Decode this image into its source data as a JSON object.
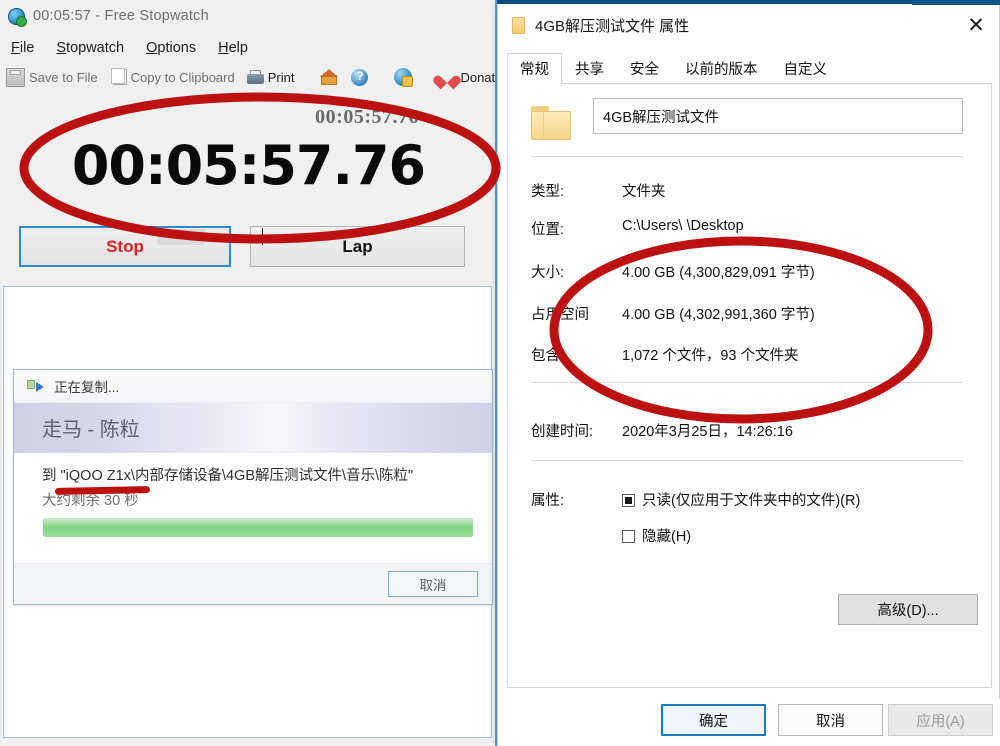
{
  "stopwatch": {
    "titlebar": {
      "icon": "stopwatch-app-icon",
      "title": "00:05:57 - Free Stopwatch"
    },
    "menu": [
      {
        "label": "File"
      },
      {
        "label": "Stopwatch"
      },
      {
        "label": "Options"
      },
      {
        "label": "Help"
      }
    ],
    "toolbar": [
      {
        "icon": "save-icon",
        "label": "Save to File"
      },
      {
        "icon": "copy-icon",
        "label": "Copy to Clipboard"
      },
      {
        "icon": "print-icon",
        "label": "Print"
      },
      {
        "icon": "home-icon",
        "label": ""
      },
      {
        "icon": "help-icon",
        "label": ""
      },
      {
        "icon": "update-icon",
        "label": ""
      },
      {
        "icon": "heart-icon",
        "label": "Donat"
      }
    ],
    "display": {
      "small_time": "00:05:57.76",
      "big_time": "00:05:57.76"
    },
    "buttons": {
      "stop": "Stop",
      "lap": "Lap"
    }
  },
  "copy_dialog": {
    "title": "正在复制...",
    "song": "走马 - 陈粒",
    "destination": "到 \"iQOO Z1x\\内部存储设备\\4GB解压测试文件\\音乐\\陈粒\"",
    "remaining": "大约剩余 30 秒",
    "cancel": "取消",
    "progress_color": "#7fd183"
  },
  "properties": {
    "title": "4GB解压测试文件 属性",
    "close_glyph": "✕",
    "tabs": [
      {
        "label": "常规",
        "active": true
      },
      {
        "label": "共享",
        "active": false
      },
      {
        "label": "安全",
        "active": false
      },
      {
        "label": "以前的版本",
        "active": false
      },
      {
        "label": "自定义",
        "active": false
      }
    ],
    "name_value": "4GB解压测试文件",
    "rows": [
      {
        "label": "类型:",
        "value": "文件夹"
      },
      {
        "label": "位置:",
        "value": "C:\\Users\\        \\Desktop"
      },
      {
        "label": "大小:",
        "value": "4.00 GB (4,300,829,091 字节)"
      },
      {
        "label": "占用空间",
        "value": "4.00 GB (4,302,991,360 字节)"
      },
      {
        "label": "包含:",
        "value": "1,072 个文件，93 个文件夹"
      },
      {
        "label": "创建时间:",
        "value": "2020年3月25日，14:26:16"
      }
    ],
    "attributes_label": "属性:",
    "readonly_label": "只读(仅应用于文件夹中的文件)(R)",
    "hidden_label": "隐藏(H)",
    "advanced_label": "高级(D)...",
    "footer": {
      "ok": "确定",
      "cancel": "取消",
      "apply": "应用(A)"
    }
  },
  "annotations": {
    "color": "#bb1111",
    "ellipses": [
      "stopwatch-time-ellipse",
      "folder-size-ellipse"
    ],
    "strike": "remaining-time-strikethrough"
  }
}
